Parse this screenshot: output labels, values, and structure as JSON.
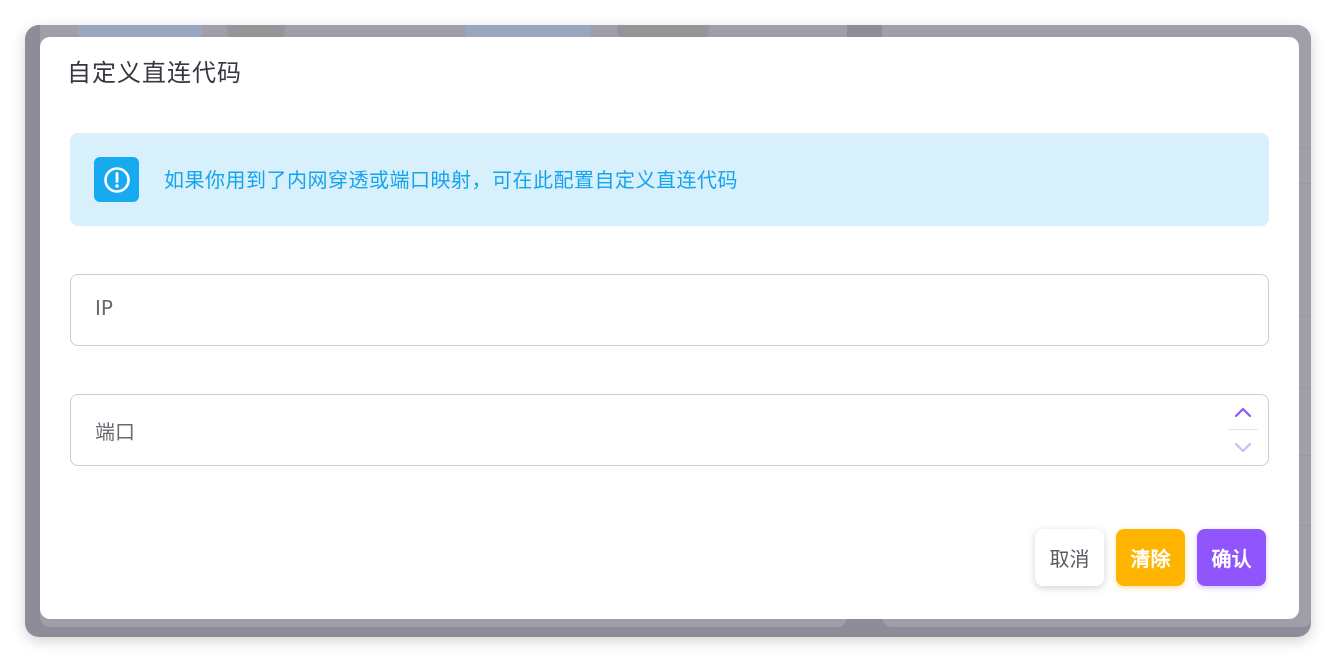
{
  "dialog": {
    "title": "自定义直连代码",
    "alert": {
      "icon": "exclamation-circle-icon",
      "text": "如果你用到了内网穿透或端口映射，可在此配置自定义直连代码",
      "color": "#14a4ec"
    },
    "fields": {
      "ip": {
        "label": "IP",
        "value": ""
      },
      "port": {
        "label": "端口",
        "value": ""
      }
    },
    "buttons": {
      "cancel": "取消",
      "clear": "清除",
      "confirm": "确认"
    },
    "colors": {
      "primary": "#9155fd",
      "warning": "#ffb400",
      "info": "#18aaf0"
    }
  }
}
